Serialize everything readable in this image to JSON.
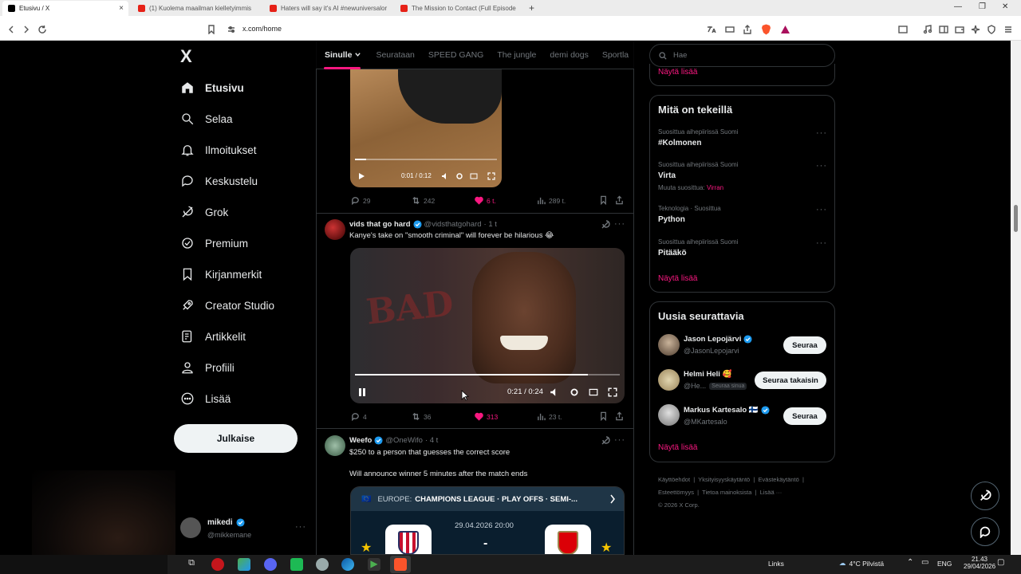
{
  "browser": {
    "tabs": [
      {
        "label": "Etusivu / X",
        "active": true
      },
      {
        "label": "(1) Kuolema maailman kielletyimmis"
      },
      {
        "label": "Haters will say it's AI #newuniversalor"
      },
      {
        "label": "The Mission to Contact (Full Episode"
      }
    ],
    "new_tab": "+",
    "url": "x.com/home",
    "links_label": "Links"
  },
  "nav": {
    "logo": "X",
    "items": [
      {
        "label": "Etusivu",
        "icon": "home-icon"
      },
      {
        "label": "Selaa",
        "icon": "search-icon"
      },
      {
        "label": "Ilmoitukset",
        "icon": "bell-icon"
      },
      {
        "label": "Keskustelu",
        "icon": "chat-icon"
      },
      {
        "label": "Grok",
        "icon": "grok-icon"
      },
      {
        "label": "Premium",
        "icon": "premium-icon"
      },
      {
        "label": "Kirjanmerkit",
        "icon": "bookmark-icon"
      },
      {
        "label": "Creator Studio",
        "icon": "rocket-icon"
      },
      {
        "label": "Artikkelit",
        "icon": "article-icon"
      },
      {
        "label": "Profiili",
        "icon": "profile-icon"
      },
      {
        "label": "Lisää",
        "icon": "more-icon"
      }
    ],
    "post_button": "Julkaise",
    "account": {
      "name": "mikedi",
      "handle": "@mikkemane",
      "more": "···"
    }
  },
  "feed": {
    "tabs": [
      "Sinulle",
      "Seurataan",
      "SPEED GANG",
      "The jungle",
      "demi dogs",
      "Sportla"
    ],
    "posts": [
      {
        "video_time": "0:01 / 0:12",
        "progress": 0.08,
        "replies": "29",
        "reposts": "242",
        "likes": "6 t.",
        "views": "289 t."
      },
      {
        "name": "vids that go hard",
        "handle": "@vidsthatgohard",
        "time": "· 1 t",
        "text": "Kanye's take on \"smooth criminal\" will forever be hilarious 😂",
        "video_time": "0:21 / 0:24",
        "progress": 0.88,
        "replies": "4",
        "reposts": "36",
        "likes": "313",
        "views": "23 t."
      },
      {
        "name": "Weefo",
        "handle": "@OneWifo",
        "time": "· 4 t",
        "text1": "$250 to a person that guesses the correct score",
        "text2": "Will announce winner 5 minutes after the match ends",
        "card_region": "EUROPE:",
        "card_title": "CHAMPIONS LEAGUE · PLAY OFFS · SEMI-...",
        "card_date": "29.04.2026 20:00",
        "card_sep": "-"
      }
    ]
  },
  "right": {
    "search_placeholder": "Hae",
    "top_show_more": "Näytä lisää",
    "trending_title": "Mitä on tekeillä",
    "trends": [
      {
        "context": "Suosittua aihepiirissä Suomi",
        "name": "#Kolmonen"
      },
      {
        "context": "Suosittua aihepiirissä Suomi",
        "name": "Virta",
        "extra_label": "Muuta suosittua:",
        "extra_link": "Virran"
      },
      {
        "context": "Teknologia · Suosittua",
        "name": "Python"
      },
      {
        "context": "Suosittua aihepiirissä Suomi",
        "name": "Pitääkö"
      }
    ],
    "trends_show_more": "Näytä lisää",
    "who_title": "Uusia seurattavia",
    "who": [
      {
        "name": "Jason Lepojärvi",
        "handle": "@JasonLepojarvi",
        "button": "Seuraa"
      },
      {
        "name": "Helmi Heli 🥰",
        "handle": "@He...",
        "badge": "Seuraa sinua",
        "button": "Seuraa takaisin"
      },
      {
        "name": "Markus Kartesalo 🇫🇮",
        "handle": "@MKartesalo",
        "button": "Seuraa"
      }
    ],
    "who_show_more": "Näytä lisää",
    "footer": [
      "Käyttöehdot",
      "Yksityisyyskäytäntö",
      "Evästekäytäntö",
      "Esteettömyys",
      "Tietoa mainoksista",
      "Lisää ···",
      "© 2026 X Corp."
    ]
  },
  "taskbar": {
    "weather": "4°C  Pilvistä",
    "lang": "ENG",
    "time": "21.43",
    "date": "29/04/2026"
  },
  "colors": {
    "accent": "#f91880",
    "verified": "#1d9bf0"
  }
}
